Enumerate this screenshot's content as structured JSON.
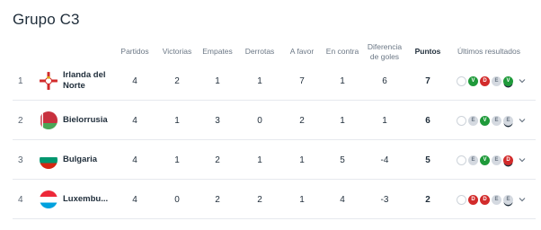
{
  "title": "Grupo C3",
  "headers": {
    "played": "Partidos",
    "wins": "Victorias",
    "draws": "Empates",
    "losses": "Derrotas",
    "gf": "A favor",
    "ga": "En contra",
    "gd_line1": "Diferencia",
    "gd_line2": "de goles",
    "points": "Puntos",
    "form": "Últimos resultados"
  },
  "rows": [
    {
      "pos": "1",
      "team_line1": "Irlanda del",
      "team_line2": "Norte",
      "played": "4",
      "wins": "2",
      "draws": "1",
      "losses": "1",
      "gf": "7",
      "ga": "1",
      "gd": "6",
      "points": "7",
      "form": [
        "",
        "V",
        "D",
        "E",
        "V"
      ]
    },
    {
      "pos": "2",
      "team_line1": "Bielorrusia",
      "team_line2": "",
      "played": "4",
      "wins": "1",
      "draws": "3",
      "losses": "0",
      "gf": "2",
      "ga": "1",
      "gd": "1",
      "points": "6",
      "form": [
        "",
        "E",
        "V",
        "E",
        "E"
      ]
    },
    {
      "pos": "3",
      "team_line1": "Bulgaria",
      "team_line2": "",
      "played": "4",
      "wins": "1",
      "draws": "2",
      "losses": "1",
      "gf": "1",
      "ga": "5",
      "gd": "-4",
      "points": "5",
      "form": [
        "",
        "E",
        "V",
        "E",
        "D"
      ]
    },
    {
      "pos": "4",
      "team_line1": "Luxembu...",
      "team_line2": "",
      "played": "4",
      "wins": "0",
      "draws": "2",
      "losses": "2",
      "gf": "1",
      "ga": "4",
      "gd": "-3",
      "points": "2",
      "form": [
        "",
        "D",
        "D",
        "E",
        "E"
      ]
    }
  ],
  "colors": {
    "win": "#1f9a3a",
    "loss": "#d22b2b",
    "draw": "#d4d9e0"
  }
}
